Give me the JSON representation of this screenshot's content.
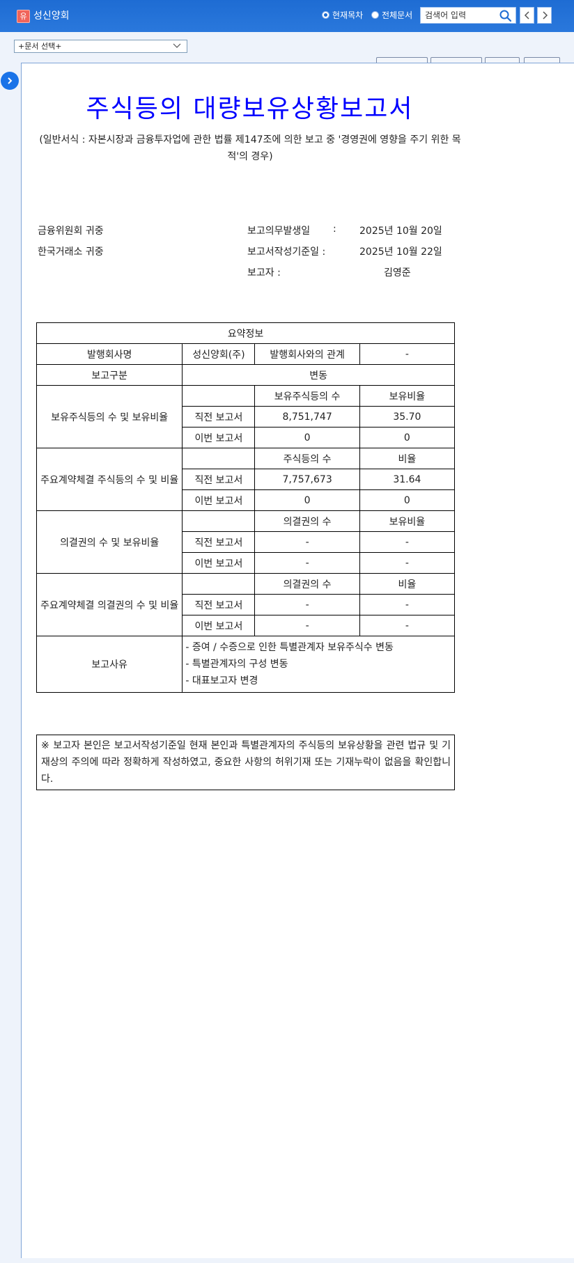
{
  "header": {
    "company_badge": "유",
    "company_name": "성신양회",
    "radio_current": "현재목차",
    "radio_all": "전체문서",
    "search_placeholder": "검색어 입력"
  },
  "toolbar": {
    "doc_select": "+문서 선택+"
  },
  "document": {
    "title": "주식등의 대량보유상황보고서",
    "subtitle": "(일반서식 : 자본시장과 금융투자업에 관한 법률 제147조에 의한 보고 중 '경영권에 영향을 주기 위한 목적'의 경우)",
    "addressee1": "금융위원회 귀중",
    "addressee2": "한국거래소 귀중",
    "obligation_label": "보고의무발생일",
    "obligation_colon": ":",
    "obligation_date": "2025년 10월 20일",
    "basis_label": "보고서작성기준일 :",
    "basis_date": "2025년 10월 22일",
    "reporter_label": "보고자 :",
    "reporter_name": "김영준"
  },
  "summary": {
    "header": "요약정보",
    "issuer_label": "발행회사명",
    "issuer_name": "성신양회(주)",
    "relation_label": "발행회사와의 관계",
    "relation_value": "-",
    "report_type_label": "보고구분",
    "report_type_value": "변동",
    "prev_label": "직전 보고서",
    "curr_label": "이번 보고서",
    "sections": [
      {
        "label": "보유주식등의 수 및 보유비율",
        "col1": "보유주식등의 수",
        "col2": "보유비율",
        "prev1": "8,751,747",
        "prev2": "35.70",
        "curr1": "0",
        "curr2": "0"
      },
      {
        "label": "주요계약체결 주식등의 수 및 비율",
        "col1": "주식등의 수",
        "col2": "비율",
        "prev1": "7,757,673",
        "prev2": "31.64",
        "curr1": "0",
        "curr2": "0"
      },
      {
        "label": "의결권의 수 및 보유비율",
        "col1": "의결권의 수",
        "col2": "보유비율",
        "prev1": "-",
        "prev2": "-",
        "curr1": "-",
        "curr2": "-"
      },
      {
        "label": "주요계약체결 의결권의 수 및 비율",
        "col1": "의결권의 수",
        "col2": "비율",
        "prev1": "-",
        "prev2": "-",
        "curr1": "-",
        "curr2": "-"
      }
    ],
    "reason_label": "보고사유",
    "reasons": [
      "- 증여 / 수증으로 인한 특별관계자 보유주식수 변동",
      "- 특별관계자의 구성 변동",
      "- 대표보고자 변경"
    ]
  },
  "notice": "※ 보고자 본인은 보고서작성기준일 현재 본인과 특별관계자의 주식등의 보유상황을 관련 법규 및 기재상의 주의에 따라 정확하게 작성하였고, 중요한 사항의 허위기재 또는 기재누락이 없음을 확인합니다.",
  "colors": {
    "header_blue": "#1e6cd3",
    "title_blue": "#0000ff",
    "badge_red": "#f0645a"
  }
}
